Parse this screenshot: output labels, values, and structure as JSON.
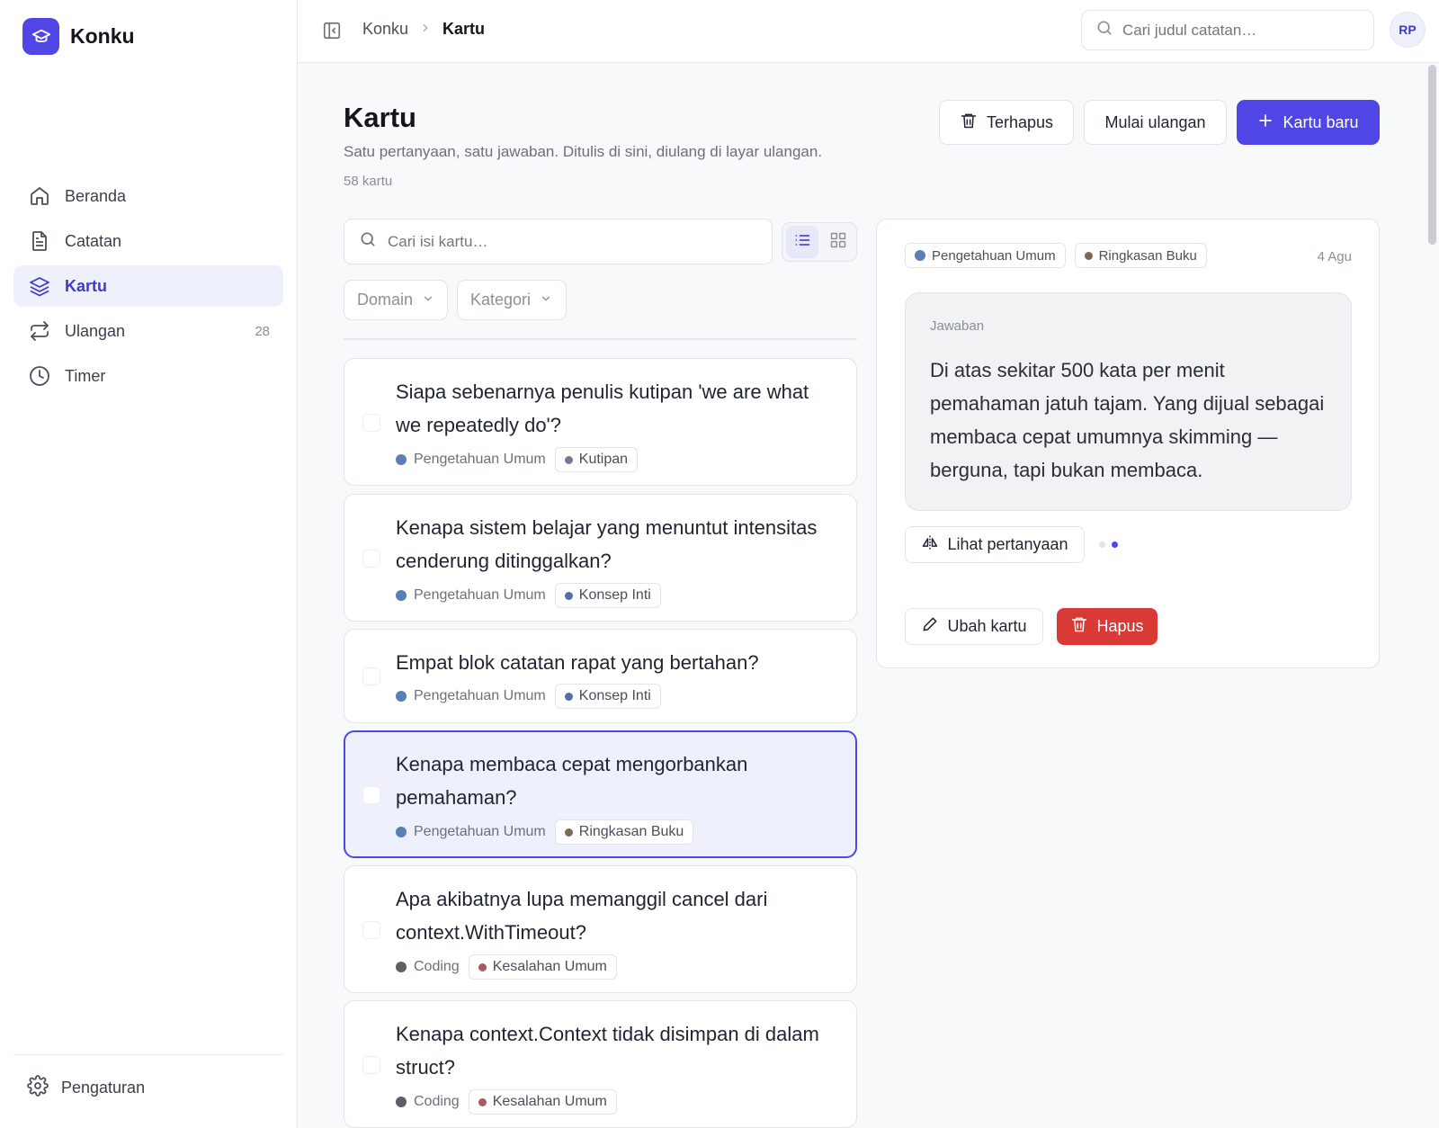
{
  "app": {
    "name": "Konku",
    "user_initials": "RP"
  },
  "sidebar": {
    "items": [
      {
        "label": "Beranda",
        "icon": "home-icon"
      },
      {
        "label": "Catatan",
        "icon": "document-icon"
      },
      {
        "label": "Kartu",
        "icon": "layers-icon",
        "active": true
      },
      {
        "label": "Ulangan",
        "icon": "repeat-icon",
        "count": "28"
      },
      {
        "label": "Timer",
        "icon": "clock-icon"
      }
    ],
    "settings_label": "Pengaturan"
  },
  "topbar": {
    "breadcrumb_root": "Konku",
    "breadcrumb_current": "Kartu",
    "search_placeholder": "Cari judul catatan…"
  },
  "header": {
    "title": "Kartu",
    "subtitle": "Satu pertanyaan, satu jawaban. Ditulis di sini, diulang di layar ulangan.",
    "count": "58 kartu",
    "trash_label": "Terhapus",
    "review_label": "Mulai ulangan",
    "new_label": "Kartu baru"
  },
  "list": {
    "search_placeholder": "Cari isi kartu…",
    "filter_domain": "Domain",
    "filter_category": "Kategori",
    "cards": [
      {
        "question": "Siapa sebenarnya penulis kutipan 'we are what we repeatedly do'?",
        "domain": "Pengetahuan Umum",
        "domain_color": "#5b7db8",
        "category": "Kutipan",
        "category_color": "#7a7696"
      },
      {
        "question": "Kenapa sistem belajar yang menuntut intensitas cenderung ditinggalkan?",
        "domain": "Pengetahuan Umum",
        "domain_color": "#5b7db8",
        "category": "Konsep Inti",
        "category_color": "#4f6fa8"
      },
      {
        "question": "Empat blok catatan rapat yang bertahan?",
        "domain": "Pengetahuan Umum",
        "domain_color": "#5b7db8",
        "category": "Konsep Inti",
        "category_color": "#4f6fa8"
      },
      {
        "question": "Kenapa membaca cepat mengorbankan pemahaman?",
        "domain": "Pengetahuan Umum",
        "domain_color": "#5b7db8",
        "category": "Ringkasan Buku",
        "category_color": "#7a6a55",
        "selected": true
      },
      {
        "question": "Apa akibatnya lupa memanggil cancel dari context.WithTimeout?",
        "domain": "Coding",
        "domain_color": "#5c6066",
        "category": "Kesalahan Umum",
        "category_color": "#a65a62"
      },
      {
        "question": "Kenapa context.Context tidak disimpan di dalam struct?",
        "domain": "Coding",
        "domain_color": "#5c6066",
        "category": "Kesalahan Umum",
        "category_color": "#a65a62"
      }
    ]
  },
  "detail": {
    "domain": "Pengetahuan Umum",
    "domain_color": "#5b7db8",
    "category": "Ringkasan Buku",
    "category_color": "#7a6a55",
    "date": "4 Agu",
    "answer_label": "Jawaban",
    "answer": "Di atas sekitar 500 kata per menit pemahaman jatuh tajam. Yang dijual sebagai membaca cepat umumnya skimming — berguna, tapi bukan membaca.",
    "flip_label": "Lihat pertanyaan",
    "edit_label": "Ubah kartu",
    "delete_label": "Hapus"
  },
  "colors": {
    "accent": "#4f46e5",
    "danger": "#d93a35"
  }
}
